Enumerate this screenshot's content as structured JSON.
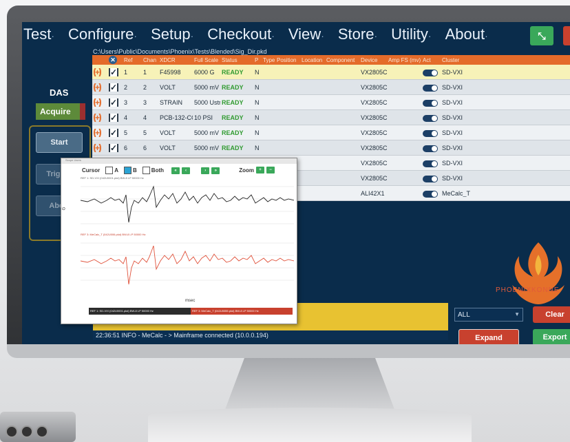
{
  "menu": {
    "items": [
      "Test",
      "Configure",
      "Setup",
      "Checkout",
      "View",
      "Store",
      "Utility",
      "About"
    ],
    "dot": "·"
  },
  "file_path": "C:\\Users\\Public\\Documents\\Phoenix\\Tests\\Blended\\Sig_Dir.pkd",
  "left_panel": {
    "das_label": "DAS",
    "acquire_label": "Acquire",
    "start_label": "Start",
    "trigger_label": "Trigger",
    "abort_label": "Abort"
  },
  "table": {
    "headers": [
      "",
      "",
      "Ref",
      "Chan",
      "XDCR",
      "Full Scale",
      "Status",
      "P",
      "Type",
      "Position",
      "Location",
      "Component",
      "Device",
      "Amp FS (mv)",
      "Act",
      "Cluster"
    ],
    "rows": [
      {
        "ref": "1",
        "chan": "1",
        "xdcr": "F45998",
        "fs": "6000 G",
        "status": "READY",
        "p": "N",
        "device": "VX2805C",
        "act": "ACTIVE",
        "cluster": "SD-VXI"
      },
      {
        "ref": "2",
        "chan": "2",
        "xdcr": "VOLT",
        "fs": "5000 mV",
        "status": "READY",
        "p": "N",
        "device": "VX2805C",
        "act": "ACTIVE",
        "cluster": "SD-VXI"
      },
      {
        "ref": "3",
        "chan": "3",
        "xdcr": "STRAIN",
        "fs": "5000 Ustr",
        "status": "READY",
        "p": "N",
        "device": "VX2805C",
        "act": "ACTIVE",
        "cluster": "SD-VXI"
      },
      {
        "ref": "4",
        "chan": "4",
        "xdcr": "PCB-132-CC",
        "fs": "10 PSI",
        "status": "READY",
        "p": "N",
        "device": "VX2805C",
        "act": "ACTIVE",
        "cluster": "SD-VXI"
      },
      {
        "ref": "5",
        "chan": "5",
        "xdcr": "VOLT",
        "fs": "5000 mV",
        "status": "READY",
        "p": "N",
        "device": "VX2805C",
        "act": "ACTIVE",
        "cluster": "SD-VXI"
      },
      {
        "ref": "6",
        "chan": "6",
        "xdcr": "VOLT",
        "fs": "5000 mV",
        "status": "READY",
        "p": "N",
        "device": "VX2805C",
        "act": "ACTIVE",
        "cluster": "SD-VXI"
      },
      {
        "ref": "",
        "chan": "",
        "xdcr": "",
        "fs": "",
        "status": "",
        "p": "",
        "device": "VX2805C",
        "act": "ACTIVE",
        "cluster": "SD-VXI"
      },
      {
        "ref": "",
        "chan": "",
        "xdcr": "",
        "fs": "",
        "status": "",
        "p": "",
        "device": "VX2805C",
        "act": "ACTIVE",
        "cluster": "SD-VXI"
      },
      {
        "ref": "",
        "chan": "",
        "xdcr": "",
        "fs": "",
        "status": "",
        "p": "",
        "device": "ALI42X1",
        "act": "ACTIVE",
        "cluster": "MeCalc_T"
      }
    ]
  },
  "controls": {
    "filter_value": "ALL",
    "clear_label": "Clear",
    "expand_label": "Expand",
    "export_label": "Export"
  },
  "log": {
    "line": "22:36:51   INFO - MeCalc - > Mainframe connected (10.0.0.194)"
  },
  "logo_text": "PHOENIXKONNE",
  "popup": {
    "title": "Scope Users",
    "cursor_label": "Cursor",
    "opt_a": "A",
    "opt_b": "B",
    "opt_both": "Both",
    "zoom_label": "Zoom",
    "chart1_title": "REF 1: SD-VXI (042U0001.pkd) BW-8 LP 50000 Hz",
    "chart2_title": "REF 3: MeCalc_T (042U006.pkd) BW-8 LP 50000 Hz",
    "x_axis_label": "msec",
    "y_axis_label": "G",
    "legend1": "REF 1: SD-VXI (042U0001.pkd) BW-8 LP 50000 Hz",
    "legend2": "REF 3: MeCalc_T (042U0055.pkd) BW-8 LP 50000 Hz"
  },
  "colors": {
    "screen_bg": "#0a2c4b",
    "header_orange": "#e46b2a",
    "ready_green": "#2f9a2f",
    "button_red": "#c8412e",
    "button_green": "#3aa85a"
  }
}
